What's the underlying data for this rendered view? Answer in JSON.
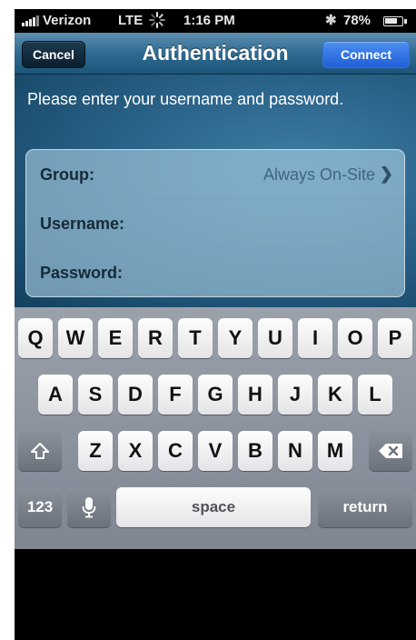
{
  "status_bar": {
    "carrier": "Verizon",
    "network": "LTE",
    "time": "1:16 PM",
    "battery_percent": "78%",
    "battery_level": 0.78,
    "icons": [
      "signal-bars-icon",
      "activity-spinner-icon",
      "bluetooth-icon",
      "battery-icon"
    ]
  },
  "navbar": {
    "cancel_label": "Cancel",
    "title": "Authentication",
    "connect_label": "Connect",
    "connect_color": "#2f6fe0"
  },
  "form": {
    "prompt": "Please enter your username and password.",
    "group_label": "Group:",
    "group_value": "Always On-Site",
    "username_label": "Username:",
    "username_value": "",
    "password_label": "Password:",
    "password_value": ""
  },
  "keyboard": {
    "row1": [
      "Q",
      "W",
      "E",
      "R",
      "T",
      "Y",
      "U",
      "I",
      "O",
      "P"
    ],
    "row2": [
      "A",
      "S",
      "D",
      "F",
      "G",
      "H",
      "J",
      "K",
      "L"
    ],
    "row3": [
      "Z",
      "X",
      "C",
      "V",
      "B",
      "N",
      "M"
    ],
    "numbers_label": "123",
    "space_label": "space",
    "return_label": "return",
    "icons": [
      "shift-icon",
      "backspace-icon",
      "microphone-icon"
    ]
  }
}
